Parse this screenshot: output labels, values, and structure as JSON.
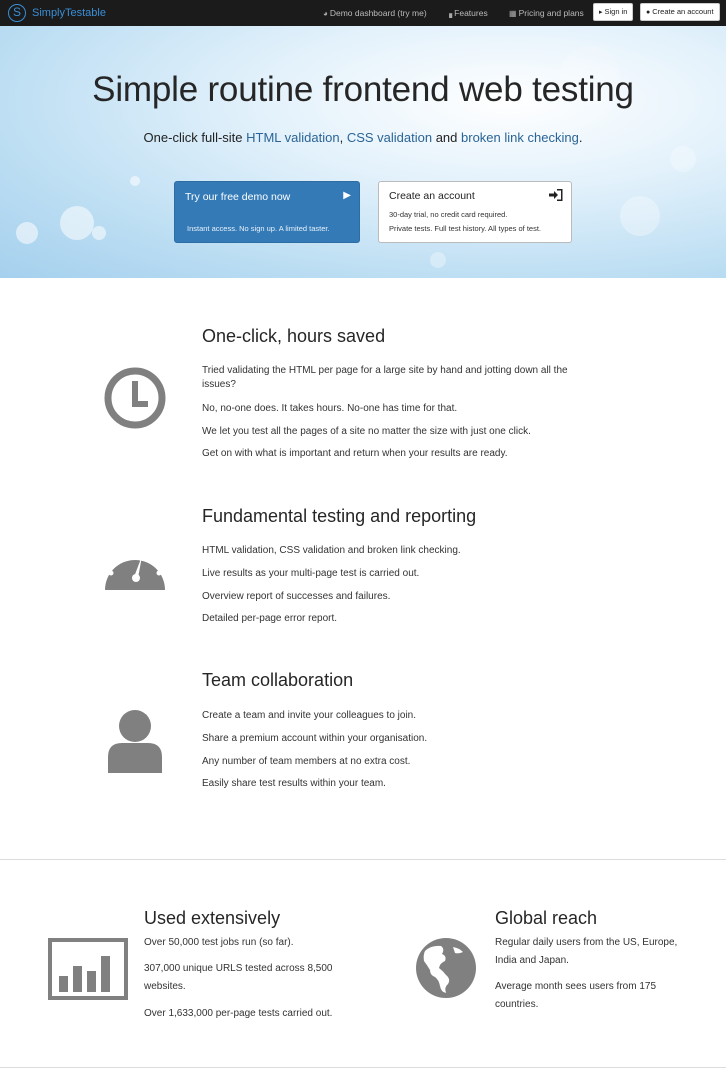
{
  "nav": {
    "brand_letter": "S",
    "brand_name": "SimplyTestable",
    "links": [
      {
        "label": "Demo dashboard (try me)",
        "icon": "dashboard-icon"
      },
      {
        "label": "Features",
        "icon": "bar-chart-icon"
      },
      {
        "label": "Pricing and plans",
        "icon": "calendar-icon"
      }
    ],
    "signin_label": "Sign in",
    "create_account_label": "Create an account"
  },
  "hero": {
    "title": "Simple routine frontend web testing",
    "subtitle_parts": [
      "One-click full-site ",
      "HTML validation",
      ", ",
      "CSS validation",
      " and ",
      "broken link checking",
      "."
    ],
    "demo_button": {
      "label": "Try our free demo now",
      "detail": "Instant access. No sign up. A limited taster."
    },
    "account_button": {
      "label": "Create an account",
      "line1": "30-day trial, no credit card required.",
      "line2": "Private tests. Full test history. All types of test."
    }
  },
  "features": [
    {
      "icon": "clock-icon",
      "title": "One-click, hours saved",
      "paragraphs": [
        "Tried validating the HTML per page for a large site by hand and jotting down all the issues?",
        "No, no-one does. It takes hours. No-one has time for that.",
        "We let you test all the pages of a site no matter the size with just one click.",
        "Get on with what is important and return when your results are ready."
      ]
    },
    {
      "icon": "dashboard-gauge-icon",
      "title": "Fundamental testing and reporting",
      "paragraphs": [
        "HTML validation, CSS validation and broken link checking.",
        "Live results as your multi-page test is carried out.",
        "Overview report of successes and failures.",
        "Detailed per-page error report."
      ]
    },
    {
      "icon": "user-icon",
      "title": "Team collaboration",
      "paragraphs": [
        "Create a team and invite your colleagues to join.",
        "Share a premium account within your organisation.",
        "Any number of team members at no extra cost.",
        "Easily share test results within your team."
      ]
    }
  ],
  "stats": [
    {
      "icon": "bar-chart-icon",
      "title": "Used extensively",
      "paragraphs": [
        "Over 50,000 test jobs run (so far).",
        "307,000 unique URLS tested across 8,500 websites.",
        "Over 1,633,000 per-page tests carried out."
      ]
    },
    {
      "icon": "globe-icon",
      "title": "Global reach",
      "paragraphs": [
        "Regular daily users from the US, Europe, India and Japan.",
        "Average month sees users from 175 countries."
      ]
    }
  ],
  "colors": {
    "navbar": "#1b1b1b",
    "brand": "#3a8fd6",
    "link": "#2a6496",
    "primary_button": "#337ab7",
    "icon_gray": "#808080"
  }
}
